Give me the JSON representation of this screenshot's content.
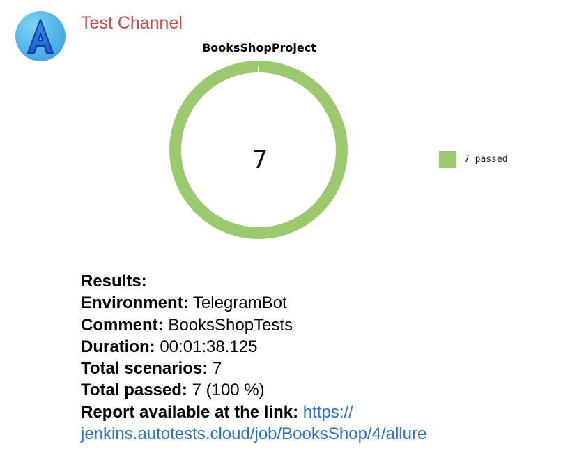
{
  "channel": {
    "name": "Test Channel",
    "avatar_letter": "A",
    "avatar_icon": "letter-a-avatar-icon"
  },
  "chart_data": {
    "type": "pie",
    "style": "donut",
    "title": "BooksShopProject",
    "center_label": "7",
    "slices": [
      {
        "label": "7 passed",
        "value": 7,
        "color": "#9bc96f"
      }
    ],
    "legend_position": "right"
  },
  "message": {
    "results_label": "Results:",
    "environment_key": "Environment:",
    "environment_value": "TelegramBot",
    "comment_key": "Comment:",
    "comment_value": "BooksShopTests",
    "duration_key": "Duration:",
    "duration_value": "00:01:38.125",
    "total_scenarios_key": "Total scenarios:",
    "total_scenarios_value": "7",
    "total_passed_key": "Total passed:",
    "total_passed_value": "7 (100 %)",
    "report_key": "Report available at the link:",
    "report_link_part1": "https://",
    "report_link_part2": "jenkins.autotests.cloud/job/BooksShop/4/allure"
  }
}
